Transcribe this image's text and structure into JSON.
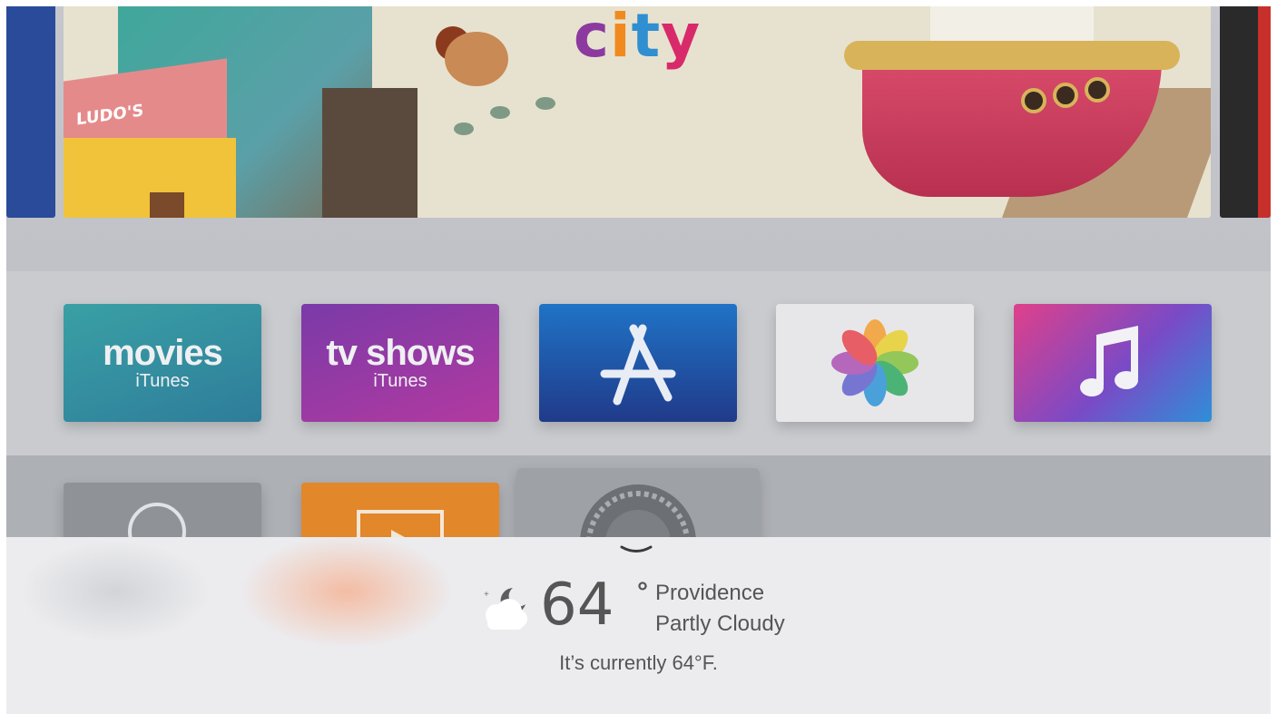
{
  "banner": {
    "title_letters": [
      "c",
      "i",
      "t",
      "y"
    ],
    "sign_text": "LUDO'S"
  },
  "apps_row1": [
    {
      "name": "movies",
      "title": "movies",
      "subtitle": "iTunes"
    },
    {
      "name": "tv-shows",
      "title": "tv shows",
      "subtitle": "iTunes"
    },
    {
      "name": "app-store",
      "icon": "app-store-icon"
    },
    {
      "name": "photos",
      "icon": "photos-flower-icon"
    },
    {
      "name": "music",
      "icon": "music-note-icon"
    }
  ],
  "apps_row2": [
    {
      "name": "search",
      "icon": "search-icon"
    },
    {
      "name": "computers",
      "icon": "play-icon"
    },
    {
      "name": "settings",
      "icon": "gear-icon"
    }
  ],
  "weather": {
    "temperature": "64",
    "degree_symbol": "°",
    "location": "Providence",
    "condition": "Partly Cloudy",
    "summary": "It’s currently 64°F.",
    "icon": "partly-cloudy-night-icon"
  }
}
